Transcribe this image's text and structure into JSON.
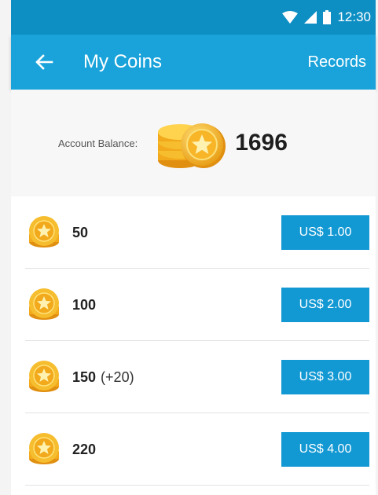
{
  "status_bar": {
    "time": "12:30"
  },
  "app_bar": {
    "title": "My Coins",
    "records_label": "Records"
  },
  "balance": {
    "label": "Account Balance:",
    "value": "1696"
  },
  "packs": [
    {
      "amount": "50",
      "bonus": "",
      "price": "US$ 1.00"
    },
    {
      "amount": "100",
      "bonus": "",
      "price": "US$ 2.00"
    },
    {
      "amount": "150",
      "bonus": "(+20)",
      "price": "US$ 3.00"
    },
    {
      "amount": "220",
      "bonus": "",
      "price": "US$ 4.00"
    }
  ],
  "colors": {
    "status_bar": "#0e8fc4",
    "app_bar": "#1aa3da",
    "price_button": "#1298d3",
    "coin_gold": "#f5b82a"
  },
  "icons": {
    "back": "arrow-left-icon",
    "wifi": "wifi-icon",
    "signal": "signal-icon",
    "battery": "battery-icon",
    "coin": "coin-icon",
    "coin_stack": "coin-stack-icon"
  }
}
